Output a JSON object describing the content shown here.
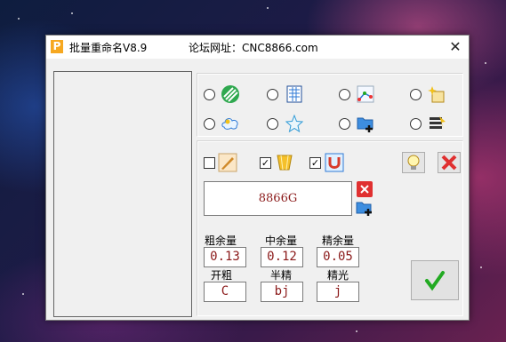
{
  "window": {
    "title": "批量重命名V8.9",
    "forum": "论坛网址：CNC8866.com",
    "app_icon_letter": "P",
    "close_glyph": "✕"
  },
  "options": {
    "radios": [
      {
        "icon": "green-stripes-icon"
      },
      {
        "icon": "blue-grid-document-icon"
      },
      {
        "icon": "nodes-path-icon"
      },
      {
        "icon": "light-sparkle-icon"
      },
      {
        "icon": "cloud-shape-icon"
      },
      {
        "icon": "star-outline-icon"
      },
      {
        "icon": "folder-add-icon"
      },
      {
        "icon": "stack-layers-icon"
      }
    ],
    "checkboxes": [
      {
        "checked": false,
        "icon": "tool-brush-icon",
        "mark": ""
      },
      {
        "checked": true,
        "icon": "cup-tool-icon",
        "mark": "✓"
      },
      {
        "checked": true,
        "icon": "magnet-tool-icon",
        "mark": "✓"
      }
    ]
  },
  "name_field": {
    "value": "8866G"
  },
  "fields": {
    "rough_label": "粗余量",
    "rough_value": "0.13",
    "mid_label": "中余量",
    "mid_value": "0.12",
    "finish_label": "精余量",
    "finish_value": "0.05",
    "open_label": "开粗",
    "open_value": "C",
    "semi_label": "半精",
    "semi_value": "bj",
    "light_label": "精光",
    "light_value": "j"
  },
  "colors": {
    "value_text": "#8b1a1a",
    "ok_check": "#22aa22",
    "delete_red": "#e03030"
  }
}
